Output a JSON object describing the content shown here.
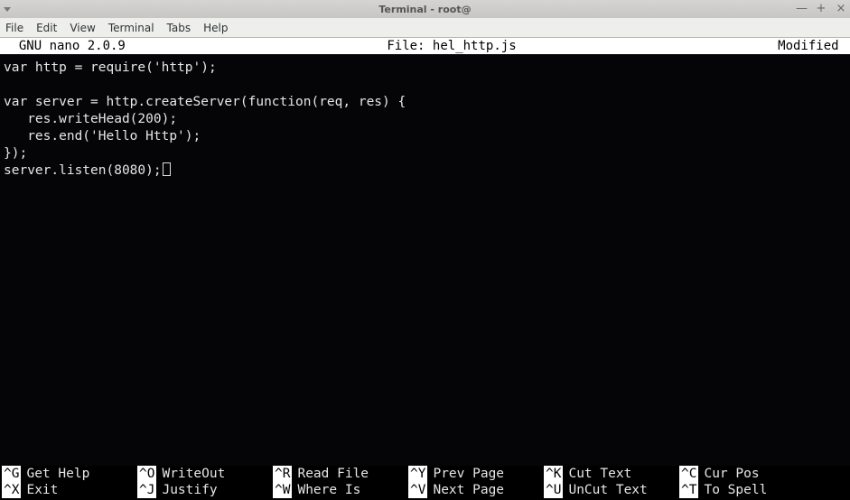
{
  "window": {
    "title": "Terminal - root@",
    "buttons": {
      "min": "—",
      "max": "+",
      "close": "×"
    }
  },
  "menubar": [
    "File",
    "Edit",
    "View",
    "Terminal",
    "Tabs",
    "Help"
  ],
  "nano": {
    "version": "  GNU nano 2.0.9",
    "file_label": "File: hel_http.js",
    "status": "Modified ",
    "content_lines": [
      "var http = require('http');",
      "",
      "var server = http.createServer(function(req, res) {",
      "   res.writeHead(200);",
      "   res.end('Hello Http');",
      "});",
      "server.listen(8080);"
    ],
    "shortcuts_row1": [
      {
        "key": "^G",
        "label": "Get Help"
      },
      {
        "key": "^O",
        "label": "WriteOut"
      },
      {
        "key": "^R",
        "label": "Read File"
      },
      {
        "key": "^Y",
        "label": "Prev Page"
      },
      {
        "key": "^K",
        "label": "Cut Text"
      },
      {
        "key": "^C",
        "label": "Cur Pos"
      }
    ],
    "shortcuts_row2": [
      {
        "key": "^X",
        "label": "Exit"
      },
      {
        "key": "^J",
        "label": "Justify"
      },
      {
        "key": "^W",
        "label": "Where Is"
      },
      {
        "key": "^V",
        "label": "Next Page"
      },
      {
        "key": "^U",
        "label": "UnCut Text"
      },
      {
        "key": "^T",
        "label": "To Spell"
      }
    ]
  }
}
